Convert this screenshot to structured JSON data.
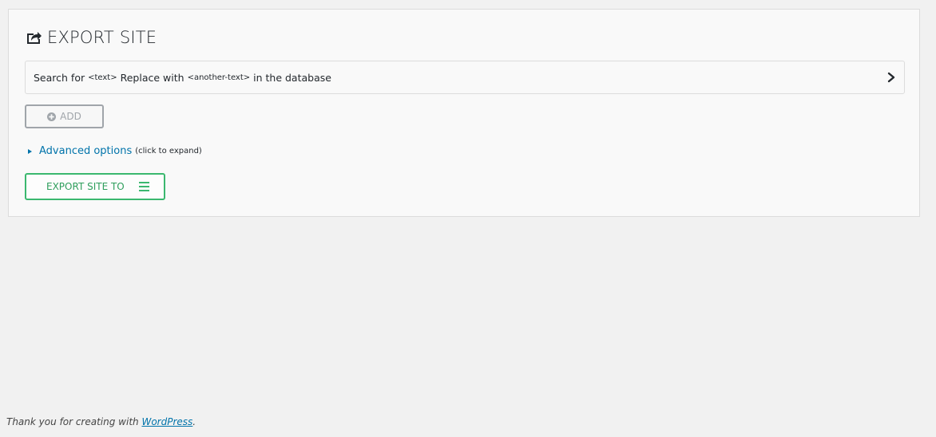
{
  "panel": {
    "title": "EXPORT SITE",
    "title_icon": "share-icon"
  },
  "replace_row": {
    "prefix": "Search for",
    "text_token": "<text>",
    "middle": "Replace with",
    "another_token": "<another-text>",
    "suffix": "in the database",
    "icon": "chevron-right-icon"
  },
  "add_button": {
    "label": "ADD",
    "icon": "plus-circle-icon"
  },
  "advanced": {
    "link": "Advanced options",
    "hint": "(click to expand)"
  },
  "export_button": {
    "label": "EXPORT SITE TO",
    "icon": "menu-icon",
    "color": "#3bb86f"
  },
  "footer": {
    "text": "Thank you for creating with",
    "link": "WordPress",
    "punct": "."
  }
}
